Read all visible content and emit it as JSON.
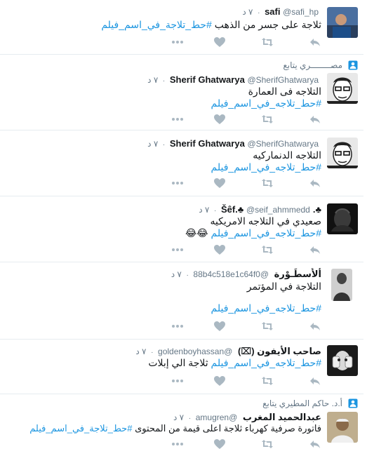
{
  "tweets": [
    {
      "context": "",
      "name": "safi",
      "handle": "@safi_hp",
      "time": "٧ د",
      "text": "ثلاجة على جسر من الذهب",
      "hashtag": "#حط_تلاجة_في_اسم_فيلم",
      "avatar": "avatar-photo"
    },
    {
      "context": "مصــــــــري يتابع",
      "name": "Sherif Ghatwarya",
      "handle": "@SherifGhatwarya",
      "time": "٧ د",
      "text": "التلاجه فى العمارة",
      "hashtag": "#حط_تلاجه_في_اسم_فيلم",
      "avatar": "avatar-photo"
    },
    {
      "context": "",
      "name": "Sherif Ghatwarya",
      "handle": "@SherifGhatwarya",
      "time": "٧ د",
      "text": "التلاجه الدنماركيه",
      "hashtag": "#حط_تلاجه_في_اسم_فيلم",
      "avatar": "avatar-photo"
    },
    {
      "context": "",
      "name": "♣.Šêf.♣",
      "handle": "@seif_ahmmedd",
      "time": "٧ د",
      "text": "صعيدي في التلاجه الامريكيه",
      "hashtag": "#حط_تلاجه_في_اسم_فيلم",
      "emoji": "😂😂",
      "avatar": "avatar-photo"
    },
    {
      "context": "",
      "name": "أَلأُسطَـوْرة",
      "handle": "@88b4c518e1c64f0",
      "time": "٧ د",
      "text": "التلاجة في المؤتمر",
      "hashtag": "#حط_تلاجه_في_اسم_فيلم",
      "avatar": "avatar-photo"
    },
    {
      "context": "",
      "name": "صاحب الأيفون (⌧)",
      "handle": "@goldenboyhassan",
      "time": "٧ د",
      "text": "ثلاجة الي إبلات",
      "hashtag": "#حط_تلاجه_في_اسم_فيلم",
      "avatar": "avatar-photo"
    },
    {
      "context": "أ.د. حاكم المطيري يتابع",
      "name": "عبدالحميد المغرب",
      "handle": "@amugren",
      "time": "٧ د",
      "text": "فاتورة صرفية كهرباء ثلاجة اعلى قيمة من المحتوى",
      "hashtag": "#حط_تلاجة_في_اسم_فيلم",
      "avatar": "avatar-photo"
    }
  ],
  "colors": {
    "link": "#1b95e0",
    "meta": "#657786",
    "action": "#aab8c2",
    "divider": "#e6ecf0"
  }
}
